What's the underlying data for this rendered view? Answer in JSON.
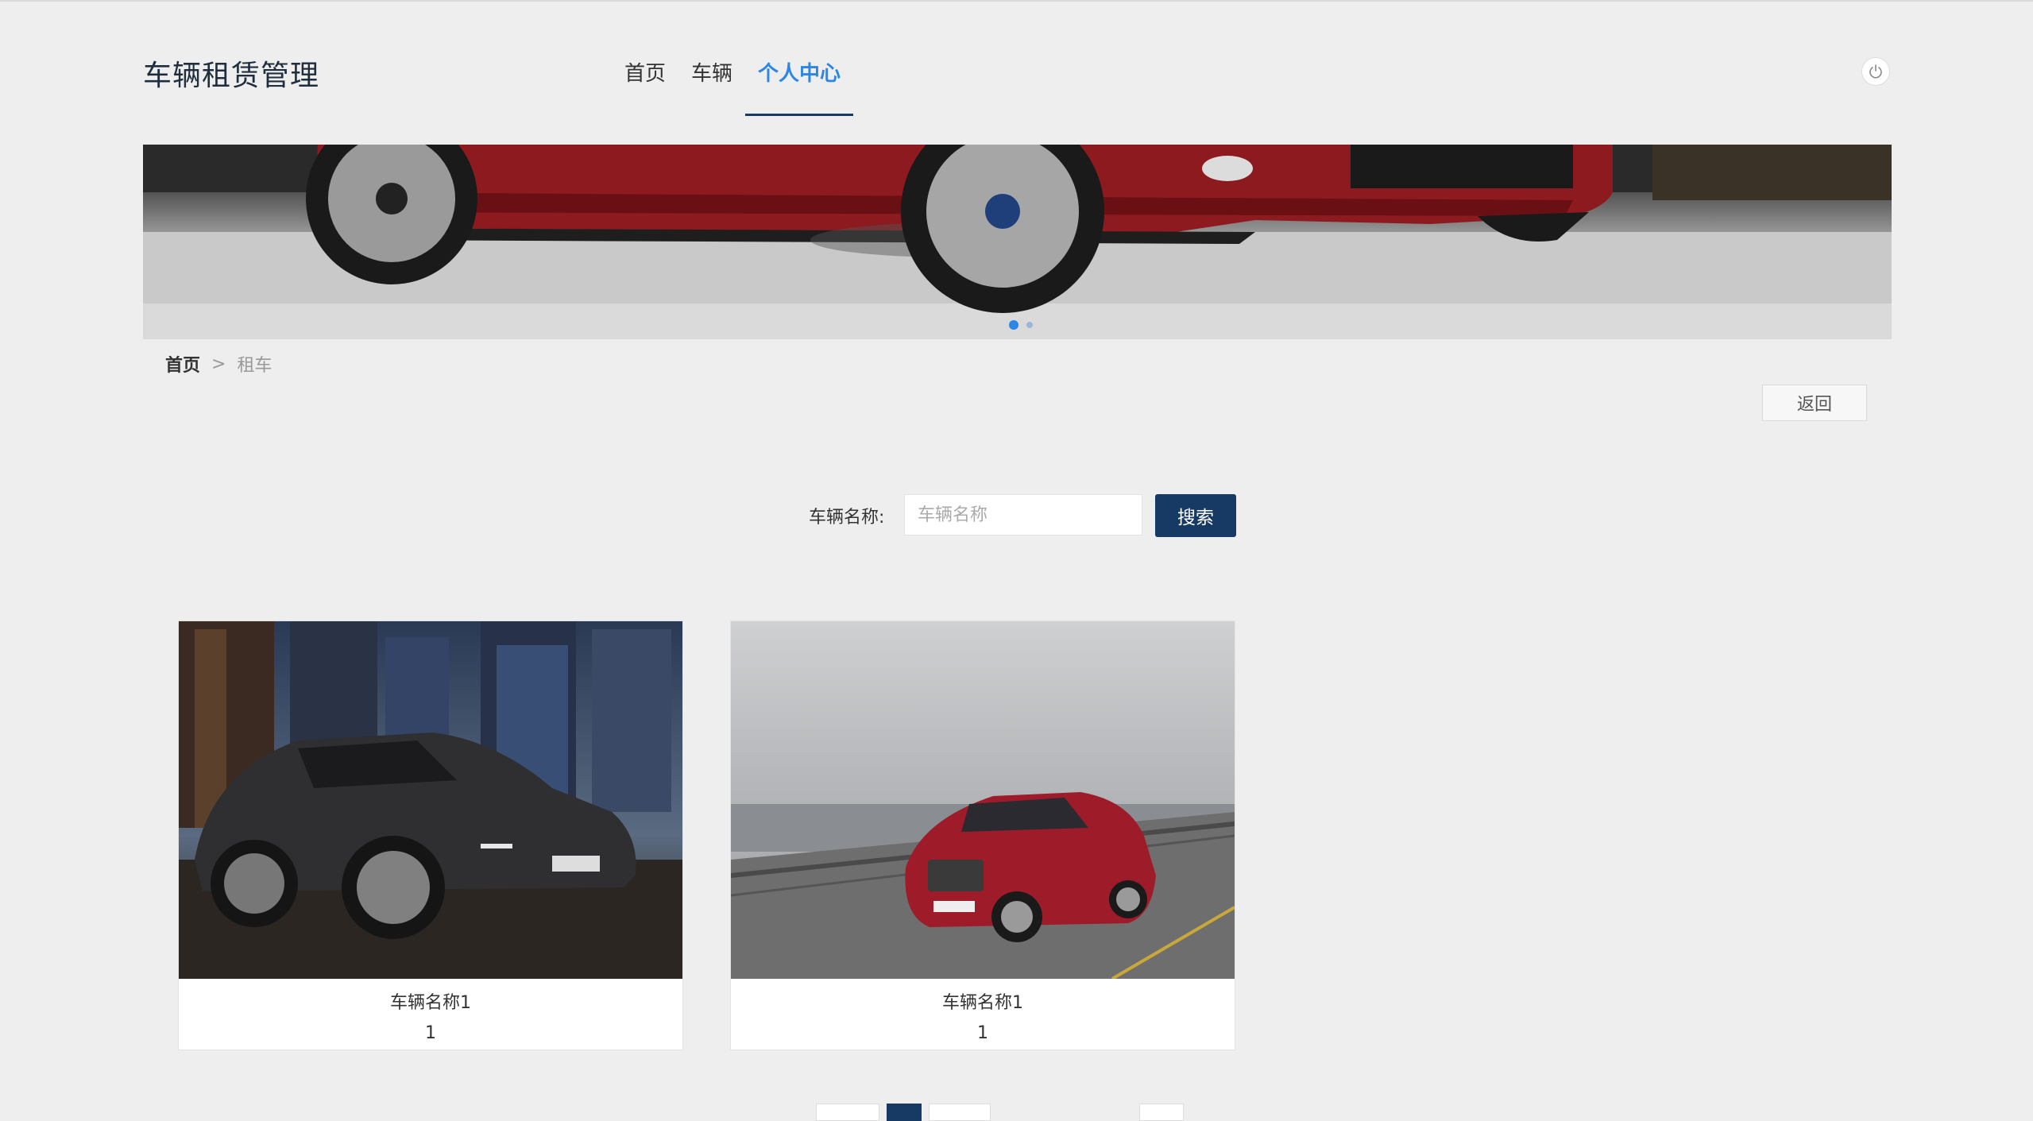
{
  "header": {
    "brand": "车辆租赁管理",
    "nav": [
      {
        "label": "首页",
        "active": false
      },
      {
        "label": "车辆",
        "active": false
      },
      {
        "label": "个人中心",
        "active": true
      }
    ],
    "power_icon": "power-icon"
  },
  "banner": {
    "slide_count": 2,
    "active_slide": 1
  },
  "breadcrumb": {
    "home": "首页",
    "separator": ">",
    "current": "租车"
  },
  "actions": {
    "back_label": "返回"
  },
  "search": {
    "label": "车辆名称:",
    "placeholder": "车辆名称",
    "value": "",
    "button_label": "搜索"
  },
  "cars": [
    {
      "name": "车辆名称1",
      "price": "1"
    },
    {
      "name": "车辆名称1",
      "price": "1"
    }
  ],
  "colors": {
    "accent": "#2b86e6",
    "primary": "#163a63",
    "background": "#eeeeee"
  }
}
